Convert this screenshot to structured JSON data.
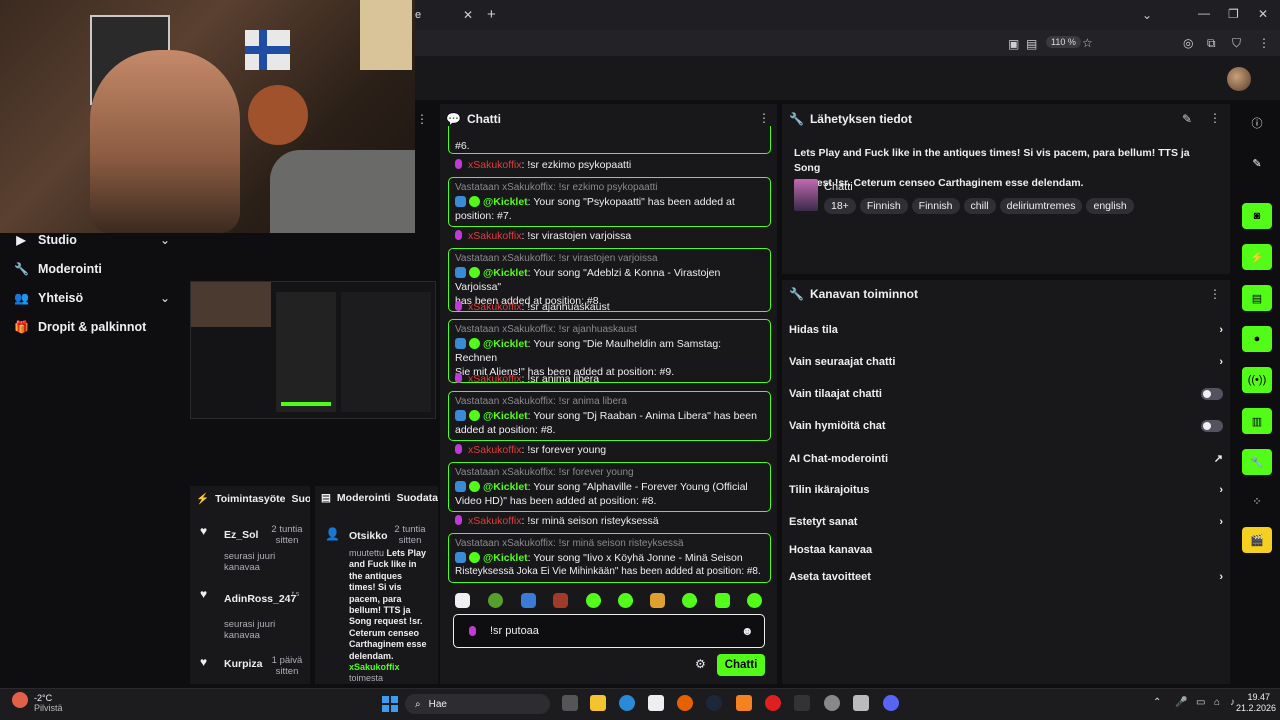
{
  "browser": {
    "tab_title": "e",
    "zoom": "110 %",
    "window_controls": [
      "chevron-down-icon",
      "minimize-icon",
      "maximize-icon",
      "close-icon"
    ]
  },
  "left_menu": {
    "items": [
      {
        "label": "Studio",
        "icon": "video-icon",
        "expandable": true
      },
      {
        "label": "Moderointi",
        "icon": "wrench-icon",
        "expandable": false
      },
      {
        "label": "Yhteisö",
        "icon": "people-icon",
        "expandable": true
      },
      {
        "label": "Dropit & palkinnot",
        "icon": "gift-icon",
        "expandable": false
      }
    ]
  },
  "chat": {
    "title": "Chatti",
    "messages": [
      {
        "kind": "reply_tail",
        "text": "#6."
      },
      {
        "kind": "user",
        "user": "xSakukoffix",
        "text": ": !sr ezkimo psykopaatti"
      },
      {
        "kind": "reply",
        "ref": "Vastataan xSakukoffix: !sr ezkimo psykopaatti",
        "bot": "@Kicklet",
        "text": ": Your song \"Psykopaatti\" has been added at",
        "text2": "position: #7."
      },
      {
        "kind": "user",
        "user": "xSakukoffix",
        "text": ": !sr virastojen varjoissa"
      },
      {
        "kind": "reply",
        "ref": "Vastataan xSakukoffix: !sr virastojen varjoissa",
        "bot": "@Kicklet",
        "text": ": Your song \"Adeblzi & Konna - Virastojen Varjoissa\"",
        "text2": "has been added at position: #8."
      },
      {
        "kind": "user",
        "user": "xSakukoffix",
        "text": ": !sr ajanhuaskaust"
      },
      {
        "kind": "reply",
        "ref": "Vastataan xSakukoffix: !sr ajanhuaskaust",
        "bot": "@Kicklet",
        "text": ": Your song \"Die Maulheldin am Samstag: Rechnen",
        "text2": "Sie mit Aliens!\" has been added at position: #9."
      },
      {
        "kind": "user",
        "user": "xSakukoffix",
        "text": ": !sr anima libera"
      },
      {
        "kind": "reply",
        "ref": "Vastataan xSakukoffix: !sr anima libera",
        "bot": "@Kicklet",
        "text": ": Your song \"Dj Raaban - Anima Libera\" has been",
        "text2": "added at position: #8."
      },
      {
        "kind": "user",
        "user": "xSakukoffix",
        "text": ": !sr forever young"
      },
      {
        "kind": "reply",
        "ref": "Vastataan xSakukoffix: !sr forever young",
        "bot": "@Kicklet",
        "text": ": Your song \"Alphaville - Forever Young (Official",
        "text2": "Video HD)\" has been added at position: #8."
      },
      {
        "kind": "user",
        "user": "xSakukoffix",
        "text": ": !sr minä seison risteyksessä"
      },
      {
        "kind": "reply",
        "ref": "Vastataan xSakukoffix: !sr minä seison risteyksessä",
        "bot": "@Kicklet",
        "text": ": Your song \"Iivo x Köyhä Jonne - Minä Seison",
        "text2": "Risteyksessä Joka Ei Vie Mihinkään\" has been added at position: #8."
      }
    ],
    "input_value": "!sr putoaa",
    "send_label": "Chatti"
  },
  "info": {
    "title": "Lähetyksen tiedot",
    "stream_title_line1": "Lets Play and Fuck like in the antiques times! Si vis pacem, para bellum! TTS ja Song",
    "stream_title_line2": "request !sr. Ceterum censeo Carthaginem esse delendam.",
    "category": "Chatti",
    "tags": [
      "18+",
      "Finnish",
      "Finnish",
      "chill",
      "deliriumtremes",
      "english"
    ]
  },
  "actions": {
    "title": "Kanavan toiminnot",
    "rows": [
      {
        "label": "Hidas tila",
        "control": "chevron"
      },
      {
        "label": "Vain seuraajat chatti",
        "control": "chevron"
      },
      {
        "label": "Vain tilaajat chatti",
        "control": "toggle"
      },
      {
        "label": "Vain hymiöitä chat",
        "control": "toggle"
      },
      {
        "label": "AI Chat-moderointi",
        "control": "external"
      },
      {
        "label": "Tilin ikärajoitus",
        "control": "chevron"
      },
      {
        "label": "Estetyt sanat",
        "control": "chevron"
      },
      {
        "label": "Hostaa kanavaa",
        "control": "none"
      },
      {
        "label": "Aseta tavoitteet",
        "control": "chevron"
      }
    ]
  },
  "activity": {
    "title": "Toimintasyöte",
    "title_extra": "Suod",
    "items": [
      {
        "user": "Ez_Sol",
        "time": "2 tuntia sitten",
        "note": "seurasi juuri kanavaa"
      },
      {
        "user": "AdinRoss_247",
        "time": "t s",
        "note": "seurasi juuri kanavaa"
      },
      {
        "user": "Kurpiza",
        "time": "1 päivä sitten",
        "note": ""
      }
    ]
  },
  "moderation": {
    "title": "Moderointi",
    "title_extra": "Suodata",
    "item_title": "Otsikko",
    "item_time": "2 tuntia sitten",
    "body_prefix": "muutettu",
    "body_bold": "Lets Play and Fuck like in the antiques times! Si vis pacem, para bellum! TTS ja Song request !sr. Ceterum censeo Carthaginem esse delendam.",
    "actor": "xSakukoffix",
    "suffix": "toimesta"
  },
  "taskbar": {
    "weather_temp": "-2°C",
    "weather_desc": "Pilvistä",
    "search": "Hae",
    "time": "19.47",
    "date": "21.2.2026"
  }
}
